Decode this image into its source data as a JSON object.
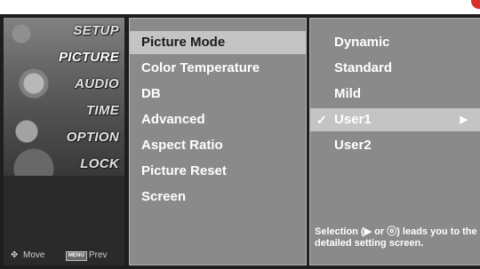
{
  "nav": {
    "items": [
      {
        "label": "SETUP"
      },
      {
        "label": "PICTURE"
      },
      {
        "label": "AUDIO"
      },
      {
        "label": "TIME"
      },
      {
        "label": "OPTION"
      },
      {
        "label": "LOCK"
      }
    ],
    "active_index": 1,
    "footer": {
      "move_icon": "✥",
      "move_label": "Move",
      "menu_key": "MENU",
      "prev_label": "Prev"
    }
  },
  "submenu": {
    "items": [
      {
        "label": "Picture Mode"
      },
      {
        "label": "Color Temperature"
      },
      {
        "label": "DB"
      },
      {
        "label": "Advanced"
      },
      {
        "label": "Aspect Ratio"
      },
      {
        "label": "Picture Reset"
      },
      {
        "label": "Screen"
      }
    ],
    "selected_index": 0
  },
  "options": {
    "items": [
      {
        "label": "Dynamic"
      },
      {
        "label": "Standard"
      },
      {
        "label": "Mild"
      },
      {
        "label": "User1",
        "checked": true,
        "has_submenu": true
      },
      {
        "label": "User2"
      }
    ],
    "check_glyph": "✓",
    "arrow_glyph": "▶",
    "help_text": "Selection (▶ or ⓞ) leads you to the detailed setting screen."
  },
  "colors": {
    "osd_background": "#1e1e1e",
    "panel": "#8a8a8a",
    "highlight": "#c4c4c4",
    "corner_dot": "#d8312b"
  }
}
